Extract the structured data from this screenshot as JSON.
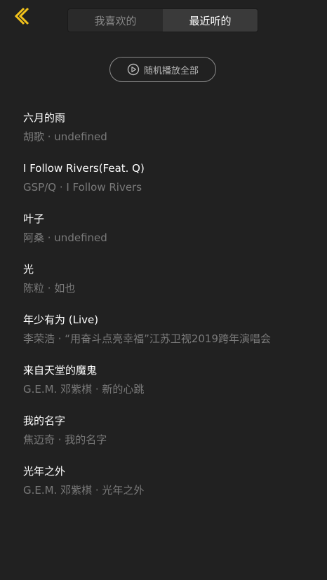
{
  "header": {
    "back_icon": "chevron-left-icon",
    "back_color": "#f2c21b",
    "tabs": [
      {
        "label": "我喜欢的",
        "active": false
      },
      {
        "label": "最近听的",
        "active": true
      }
    ]
  },
  "shuffle": {
    "icon": "play-circle-icon",
    "label": "随机播放全部"
  },
  "songs": [
    {
      "title": "六月的雨",
      "meta": "胡歌 · undefined"
    },
    {
      "title": "I Follow Rivers(Feat. Q)",
      "meta": "GSP/Q · I Follow Rivers"
    },
    {
      "title": "叶子",
      "meta": "阿桑 · undefined"
    },
    {
      "title": "光",
      "meta": "陈粒 · 如也"
    },
    {
      "title": "年少有为 (Live)",
      "meta": "李荣浩 · “用奋斗点亮幸福”江苏卫视2019跨年演唱会"
    },
    {
      "title": "来自天堂的魔鬼",
      "meta": "G.E.M. 邓紫棋 · 新的心跳"
    },
    {
      "title": "我的名字",
      "meta": "焦迈奇 · 我的名字"
    },
    {
      "title": "光年之外",
      "meta": "G.E.M. 邓紫棋 · 光年之外"
    }
  ]
}
